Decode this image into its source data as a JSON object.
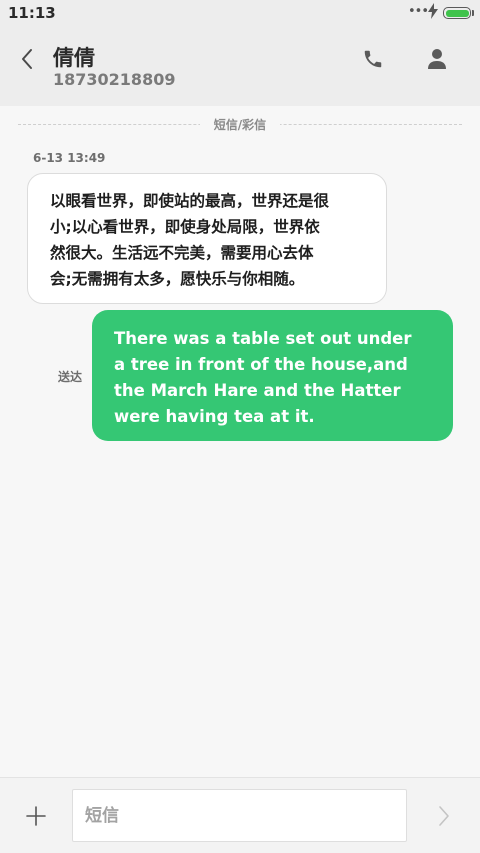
{
  "status_bar": {
    "time": "11:13",
    "signal_icon": "dots-icon",
    "charging_icon": "bolt-icon",
    "battery_icon": "battery-icon",
    "battery_color": "#3fc34b"
  },
  "header": {
    "back_icon": "chevron-left-icon",
    "contact_name": "倩倩",
    "contact_number": "18730218809",
    "call_icon": "phone-icon",
    "contact_icon": "person-icon"
  },
  "conversation": {
    "divider_label": "短信/彩信",
    "timestamp": "6-13 13:49",
    "messages": [
      {
        "direction": "incoming",
        "lines": [
          "以眼看世界，即使站的最高，世界还是很",
          "小;以心看世界，即使身处局限，世界依",
          "然很大。生活远不完美，需要用心去体",
          "会;无需拥有太多，愿快乐与你相随。"
        ]
      },
      {
        "direction": "outgoing",
        "status": "送达",
        "lines": [
          "There was a table set out under",
          "a tree in front of the house,and",
          "the March Hare and the Hatter",
          "were having tea at it."
        ],
        "bubble_color": "#35c774"
      }
    ]
  },
  "composer": {
    "add_icon": "plus-icon",
    "placeholder": "短信",
    "value": "",
    "send_icon": "chevron-right-icon"
  }
}
